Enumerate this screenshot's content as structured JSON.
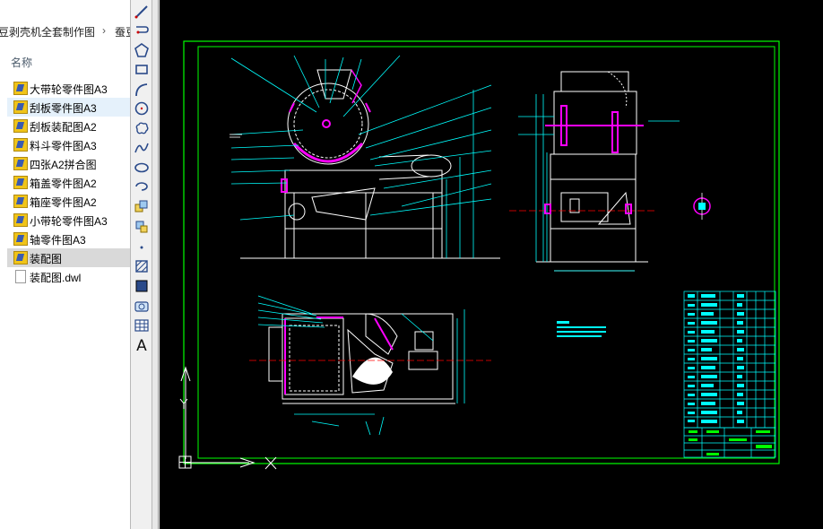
{
  "explorer": {
    "address_path": "豆剥壳机全套制作图",
    "address_next": "蚕豆",
    "column_name": "名称",
    "files": [
      {
        "label": "大带轮零件图A3",
        "icon": "dwg-file-icon",
        "state": "normal"
      },
      {
        "label": "刮板零件图A3",
        "icon": "dwg-file-icon",
        "state": "hover"
      },
      {
        "label": "刮板装配图A2",
        "icon": "dwg-file-icon",
        "state": "normal"
      },
      {
        "label": "料斗零件图A3",
        "icon": "dwg-file-icon",
        "state": "normal"
      },
      {
        "label": "四张A2拼合图",
        "icon": "dwg-file-icon",
        "state": "normal"
      },
      {
        "label": "箱盖零件图A2",
        "icon": "dwg-file-icon",
        "state": "normal"
      },
      {
        "label": "箱座零件图A2",
        "icon": "dwg-file-icon",
        "state": "normal"
      },
      {
        "label": "小带轮零件图A3",
        "icon": "dwg-file-icon",
        "state": "normal"
      },
      {
        "label": "轴零件图A3",
        "icon": "dwg-file-icon",
        "state": "normal"
      },
      {
        "label": "装配图",
        "icon": "dwg-file-icon",
        "state": "selected"
      },
      {
        "label": "装配图.dwl",
        "icon": "generic-file-icon",
        "state": "normal"
      }
    ]
  },
  "toolbar": {
    "tools": [
      "line-tool-icon",
      "construction-line-icon",
      "polygon-icon",
      "rectangle-icon",
      "arc-icon",
      "circle-icon",
      "revision-cloud-icon",
      "spline-icon",
      "ellipse-icon",
      "ellipse-arc-icon",
      "insert-block-icon",
      "make-block-icon",
      "point-icon",
      "hatch-icon",
      "gradient-icon",
      "region-icon",
      "table-icon",
      "multiline-text-icon"
    ],
    "text_tool_glyph": "A"
  },
  "colors": {
    "canvas_bg": "#000000",
    "frame": "#00ff00",
    "geometry": "#ffffff",
    "dimension": "#00ffff",
    "section": "#ff00ff",
    "centerline": "#ff0000",
    "ucs": "#ffffff"
  }
}
